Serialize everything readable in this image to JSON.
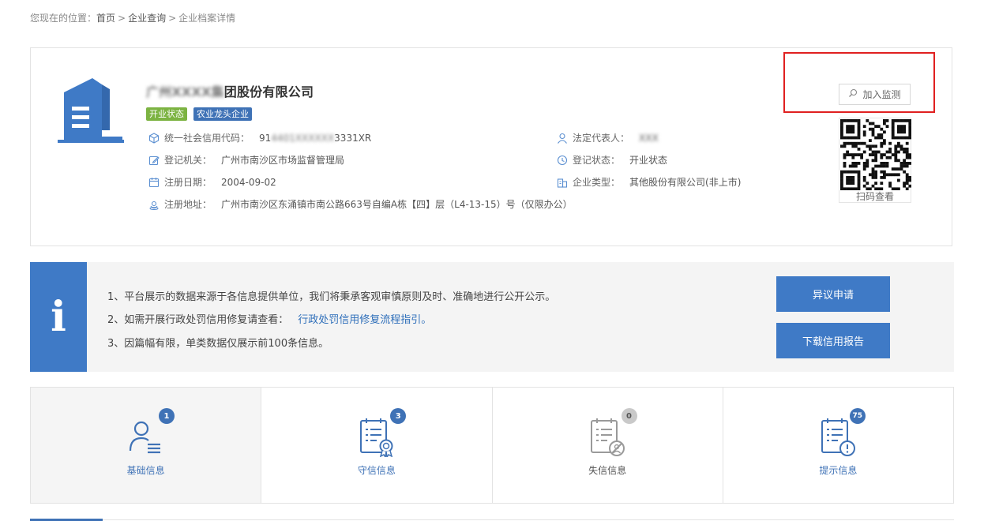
{
  "breadcrumb": {
    "prefix": "您现在的位置：",
    "items": [
      "首页",
      "企业查询",
      "企业档案详情"
    ],
    "separator": ">"
  },
  "company": {
    "name_masked": "广州XXXX集",
    "name_visible": "团股份有限公司",
    "tags": [
      "开业状态",
      "农业龙头企业"
    ],
    "credit_code_label": "统一社会信用代码：",
    "credit_code_prefix": "91",
    "credit_code_masked": "4401XXXXXX",
    "credit_code_suffix": "3331XR",
    "legal_rep_label": "法定代表人：",
    "legal_rep_masked": "XXX",
    "reg_authority_label": "登记机关：",
    "reg_authority": "广州市南沙区市场监督管理局",
    "reg_status_label": "登记状态：",
    "reg_status": "开业状态",
    "reg_date_label": "注册日期：",
    "reg_date": "2004-09-02",
    "type_label": "企业类型：",
    "type": "其他股份有限公司(非上市)",
    "address_label": "注册地址：",
    "address": "广州市南沙区东涌镇市南公路663号自编A栋【四】层（L4-13-15）号（仅限办公）"
  },
  "monitor_button": {
    "label": "加入监测",
    "icon": "search-icon"
  },
  "qr": {
    "caption": "扫码查看"
  },
  "notice": {
    "lines": [
      "1、平台展示的数据来源于各信息提供单位，我们将秉承客观审慎原则及时、准确地进行公开公示。",
      "2、如需开展行政处罚信用修复请查看：",
      "3、因篇幅有限，单类数据仅展示前100条信息。"
    ],
    "link_text": "行政处罚信用修复流程指引。",
    "buttons": [
      "异议申请",
      "下载信用报告"
    ]
  },
  "stats": [
    {
      "label": "基础信息",
      "count": "1",
      "icon": "user-list-icon",
      "color": "#3f72b6"
    },
    {
      "label": "守信信息",
      "count": "3",
      "icon": "checklist-medal-icon",
      "color": "#3f72b6"
    },
    {
      "label": "失信信息",
      "count": "0",
      "icon": "checklist-forbidden-icon",
      "color": "#9a9a9a"
    },
    {
      "label": "提示信息",
      "count": "75",
      "icon": "checklist-warning-icon",
      "color": "#3f72b6"
    }
  ],
  "colors": {
    "primary": "#3f7ac6",
    "tag_green": "#7cb342",
    "tag_blue": "#3f72b6",
    "highlight_red": "#e02020",
    "disabled_gray": "#9a9a9a"
  }
}
